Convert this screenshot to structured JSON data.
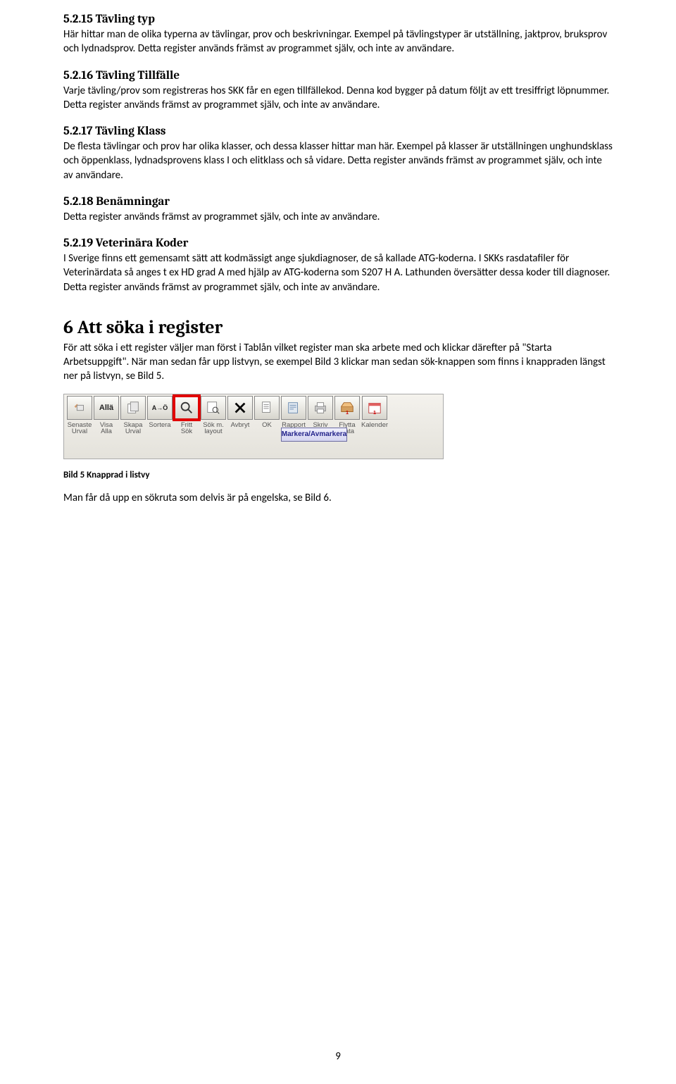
{
  "sections": {
    "s1": {
      "heading": "5.2.15 Tävling typ",
      "body": "Här hittar man de olika typerna av tävlingar, prov och beskrivningar. Exempel på tävlingstyper är utställning, jaktprov, bruksprov och lydnadsprov. Detta register används främst av programmet själv, och inte av användare."
    },
    "s2": {
      "heading": "5.2.16 Tävling Tillfälle",
      "body": "Varje tävling/prov som registreras hos SKK får en egen tillfällekod. Denna kod bygger på datum följt av ett tresiffrigt löpnummer. Detta register används främst av programmet själv, och inte av användare."
    },
    "s3": {
      "heading": "5.2.17 Tävling Klass",
      "body": "De flesta tävlingar och prov har olika klasser, och dessa klasser hittar man här. Exempel på klasser är utställningen unghundsklass och öppenklass, lydnadsprovens klass I och elitklass och så vidare. Detta register används främst av programmet själv, och inte av användare."
    },
    "s4": {
      "heading": "5.2.18 Benämningar",
      "body": "Detta register används främst av programmet själv, och inte av användare."
    },
    "s5": {
      "heading": "5.2.19 Veterinära Koder",
      "body": "I Sverige finns ett gemensamt sätt att kodmässigt ange sjukdiagnoser, de så kallade ATG-koderna. I SKKs rasdatafiler för Veterinärdata så anges t ex HD grad A med hjälp av ATG-koderna som S207 H A. Lathunden översätter dessa koder till diagnoser. Detta register används främst av programmet själv, och inte av användare."
    },
    "s6": {
      "heading": "6   Att söka i register",
      "body": "För att söka i ett register väljer man först i Tablån vilket register man ska arbete med och klickar därefter på \"Starta Arbetsuppgift\". När man sedan får upp listvyn, se exempel Bild 3 klickar man sedan sök-knappen som finns i knappraden längst ner på listvyn, se Bild 5."
    }
  },
  "toolbar": {
    "items": [
      {
        "label1": "Senaste",
        "label2": "Urval"
      },
      {
        "label1": "Visa",
        "label2": "Alla",
        "btn_text": "Allä"
      },
      {
        "label1": "Skapa",
        "label2": "Urval"
      },
      {
        "label1": "Sortera",
        "label2": "",
        "btn_text": "A→Ö"
      },
      {
        "label1": "Fritt",
        "label2": "Sök"
      },
      {
        "label1": "Sök m.",
        "label2": "layout"
      },
      {
        "label1": "Avbryt",
        "label2": ""
      },
      {
        "label1": "OK",
        "label2": ""
      },
      {
        "label1": "Rapport",
        "label2": ""
      },
      {
        "label1": "Skriv",
        "label2": ""
      },
      {
        "label1": "Flytta",
        "label2": "Data"
      },
      {
        "label1": "Kalender",
        "label2": ""
      }
    ],
    "marker": "Markera/Avmarkera"
  },
  "figure_caption": "Bild 5 Knapprad i listvy",
  "post_figure_text": "Man får då upp en sökruta som delvis är på engelska, se Bild 6.",
  "page_number": "9"
}
